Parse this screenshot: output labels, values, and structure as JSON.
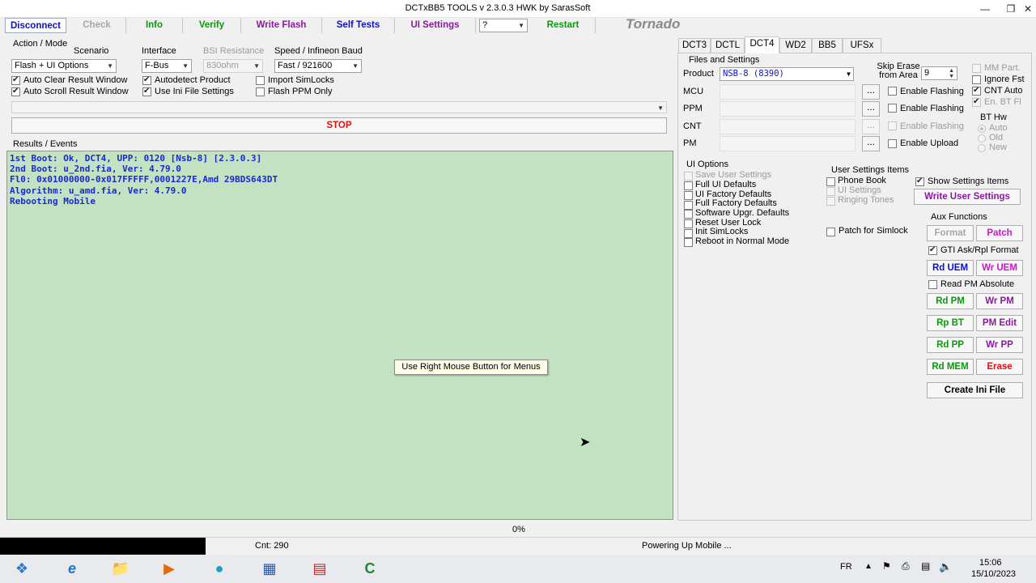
{
  "window": {
    "title": "DCTxBB5 TOOLS v 2.3.0.3 HWK by SarasSoft"
  },
  "toolbar": {
    "disconnect": "Disconnect",
    "check": "Check",
    "info": "Info",
    "verify": "Verify",
    "write_flash": "Write Flash",
    "self_tests": "Self Tests",
    "ui_settings": "UI Settings",
    "help_select": "?",
    "restart": "Restart",
    "brand": "Tornado"
  },
  "action_mode": {
    "group_label": "Action / Mode",
    "scenario_label": "Scenario",
    "scenario_value": "Flash + UI Options",
    "interface_label": "Interface",
    "interface_value": "F-Bus",
    "bsi_label": "BSI Resistance",
    "bsi_value": "830ohm",
    "speed_label": "Speed / Infineon Baud",
    "speed_value": "Fast / 921600",
    "auto_clear": "Auto Clear Result Window",
    "auto_scroll": "Auto Scroll Result Window",
    "autodetect": "Autodetect Product",
    "use_ini": "Use Ini File Settings",
    "import_simlocks": "Import SimLocks",
    "flash_ppm_only": "Flash PPM Only",
    "stop": "STOP"
  },
  "results": {
    "label": "Results / Events",
    "lines": [
      "1st Boot: Ok, DCT4, UPP: 0120 [Nsb-8] [2.3.0.3]",
      "2nd Boot: u_2nd.fia, Ver: 4.79.0",
      "Fl0: 0x01000000-0x017FFFFF,0001227E,Amd 29BDS643DT",
      "Algorithm: u_amd.fia, Ver: 4.79.0",
      "Rebooting Mobile"
    ],
    "tooltip": "Use Right Mouse Button for Menus"
  },
  "tabs": [
    "DCT3",
    "DCTL",
    "DCT4",
    "WD2",
    "BB5",
    "UFSx"
  ],
  "files": {
    "group_label": "Files and Settings",
    "product_label": "Product",
    "product_value": "NSB-8   (8390)",
    "skip_erase_label": "Skip Erase from Area",
    "skip_erase_value": "9",
    "mcu": "MCU",
    "ppm": "PPM",
    "cnt": "CNT",
    "pm": "PM",
    "dots": "...",
    "enable_flashing_1": "Enable Flashing",
    "enable_flashing_2": "Enable Flashing",
    "enable_flashing_3": "Enable Flashing",
    "enable_upload": "Enable Upload",
    "mm_part": "MM Part.",
    "ignore_fst": "Ignore Fst",
    "cnt_auto": "CNT Auto",
    "en_bt_fl": "En. BT Fl",
    "bt_hw_label": "BT Hw",
    "bt_auto": "Auto",
    "bt_old": "Old",
    "bt_new": "New"
  },
  "ui_options": {
    "group_label": "UI Options",
    "items": [
      "Save User Settings",
      "Full UI Defaults",
      "UI Factory Defaults",
      "Full Factory Defaults",
      "Software Upgr. Defaults",
      "Reset User Lock",
      "Init SimLocks",
      "Reboot in Normal Mode"
    ]
  },
  "user_settings": {
    "group_label": "User Settings Items",
    "phone_book": "Phone Book",
    "ui_settings": "UI Settings",
    "ringing_tones": "Ringing Tones",
    "show_items": "Show Settings Items",
    "write_user_settings": "Write User Settings",
    "patch_simlock": "Patch for Simlock"
  },
  "aux": {
    "group_label": "Aux Functions",
    "format": "Format",
    "patch": "Patch",
    "gti": "GTI Ask/Rpl Format",
    "rd_uem": "Rd UEM",
    "wr_uem": "Wr UEM",
    "read_pm_abs": "Read PM Absolute",
    "rd_pm": "Rd PM",
    "wr_pm": "Wr PM",
    "rp_bt": "Rp BT",
    "pm_edit": "PM Edit",
    "rd_pp": "Rd PP",
    "wr_pp": "Wr PP",
    "rd_mem": "Rd MEM",
    "erase": "Erase",
    "create_ini": "Create Ini File"
  },
  "status": {
    "progress_text": "0%",
    "progress": 0,
    "count": "Cnt: 290",
    "message": "Powering Up Mobile ..."
  },
  "taskbar": {
    "lang": "FR",
    "time": "15:06",
    "date": "15/10/2023"
  },
  "colors": {
    "blue": "#1010c8",
    "green": "#0a9a0a",
    "purple": "#8a1aa0",
    "red": "#e01010",
    "log_bg": "#c2e2c2"
  }
}
